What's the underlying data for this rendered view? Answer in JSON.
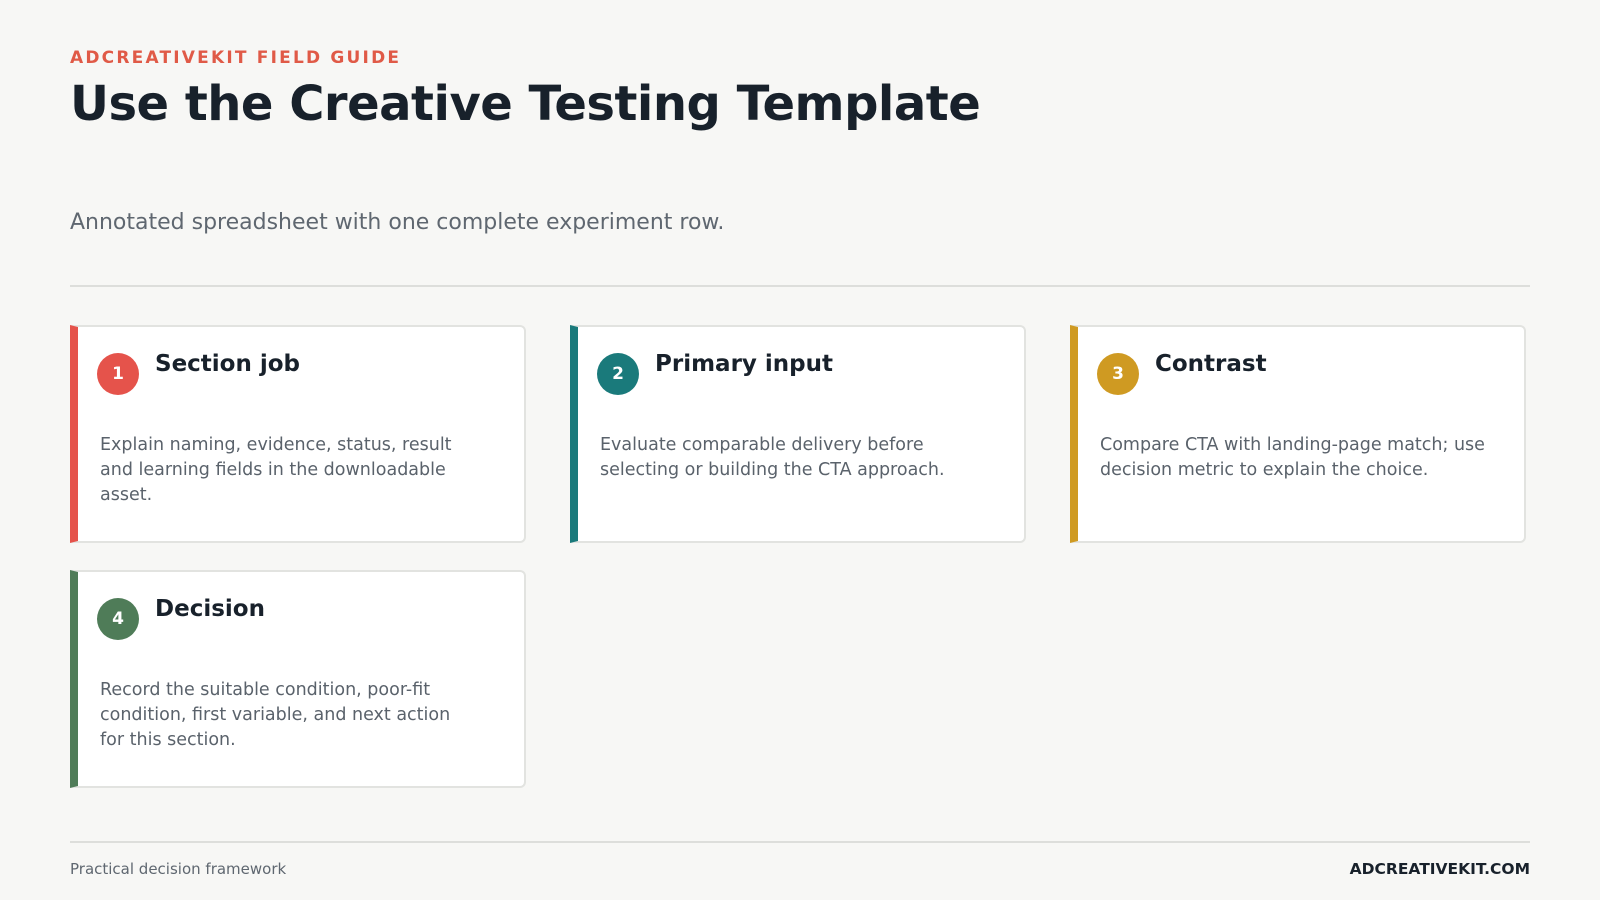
{
  "header": {
    "eyebrow": "ADCREATIVEKIT FIELD GUIDE",
    "title": "Use the Creative Testing Template",
    "subtitle": "Annotated spreadsheet with one complete experiment row."
  },
  "colors": {
    "accent": "#e05a47",
    "red": "#e5534b",
    "teal": "#1a7a7b",
    "gold": "#cf9a22",
    "green": "#4f7c58"
  },
  "cards": [
    {
      "number": "1",
      "title": "Section job",
      "text": "Explain naming, evidence, status, result and learning fields in the downloadable asset.",
      "color": "#e5534b"
    },
    {
      "number": "2",
      "title": "Primary input",
      "text": "Evaluate comparable delivery before selecting or building the CTA approach.",
      "color": "#1a7a7b"
    },
    {
      "number": "3",
      "title": "Contrast",
      "text": "Compare CTA with landing-page match; use decision metric to explain the choice.",
      "color": "#cf9a22"
    },
    {
      "number": "4",
      "title": "Decision",
      "text": "Record the suitable condition, poor-fit condition, first variable, and next action for this section.",
      "color": "#4f7c58"
    }
  ],
  "footer": {
    "left": "Practical decision framework",
    "right": "ADCREATIVEKIT.COM"
  }
}
